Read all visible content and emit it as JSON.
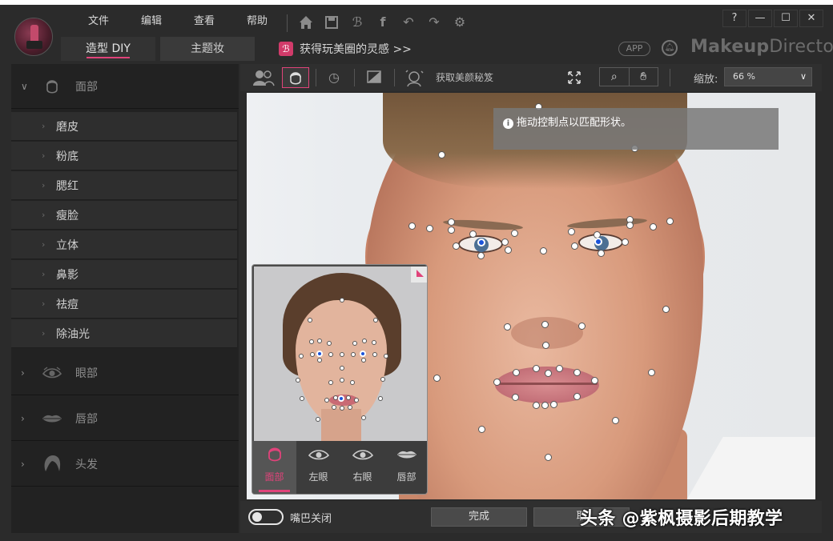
{
  "menu": [
    "文件",
    "编辑",
    "查看",
    "帮助"
  ],
  "window_controls": [
    "?",
    "—",
    "☐",
    "✕"
  ],
  "tabs": [
    "造型 DIY",
    "主题妆"
  ],
  "promo": {
    "text": "获得玩美圈的灵感 >>"
  },
  "app_badge": "APP",
  "brand": {
    "bold": "Makeup",
    "rest": "Director"
  },
  "left_panel": {
    "face": {
      "label": "面部",
      "items": [
        "磨皮",
        "粉底",
        "腮红",
        "瘦脸",
        "立体",
        "鼻影",
        "祛痘",
        "除油光"
      ]
    },
    "eyes": "眼部",
    "lips": "唇部",
    "hair": "头发"
  },
  "toolbar": {
    "beauty_tips": "获取美颜秘笈",
    "zoom_label": "缩放:",
    "zoom_value": "66 %"
  },
  "hint": "拖动控制点以匹配形状。",
  "reference_tabs": [
    "面部",
    "左眼",
    "右眼",
    "唇部"
  ],
  "bottom": {
    "toggle_label": "嘴巴关闭",
    "done": "完成",
    "cancel": "取"
  },
  "watermark": "头条 @紫枫摄影后期教学",
  "colors": {
    "accent": "#e0437a",
    "panel": "#2b2b2b",
    "control_point_blue": "#1b53d9"
  }
}
